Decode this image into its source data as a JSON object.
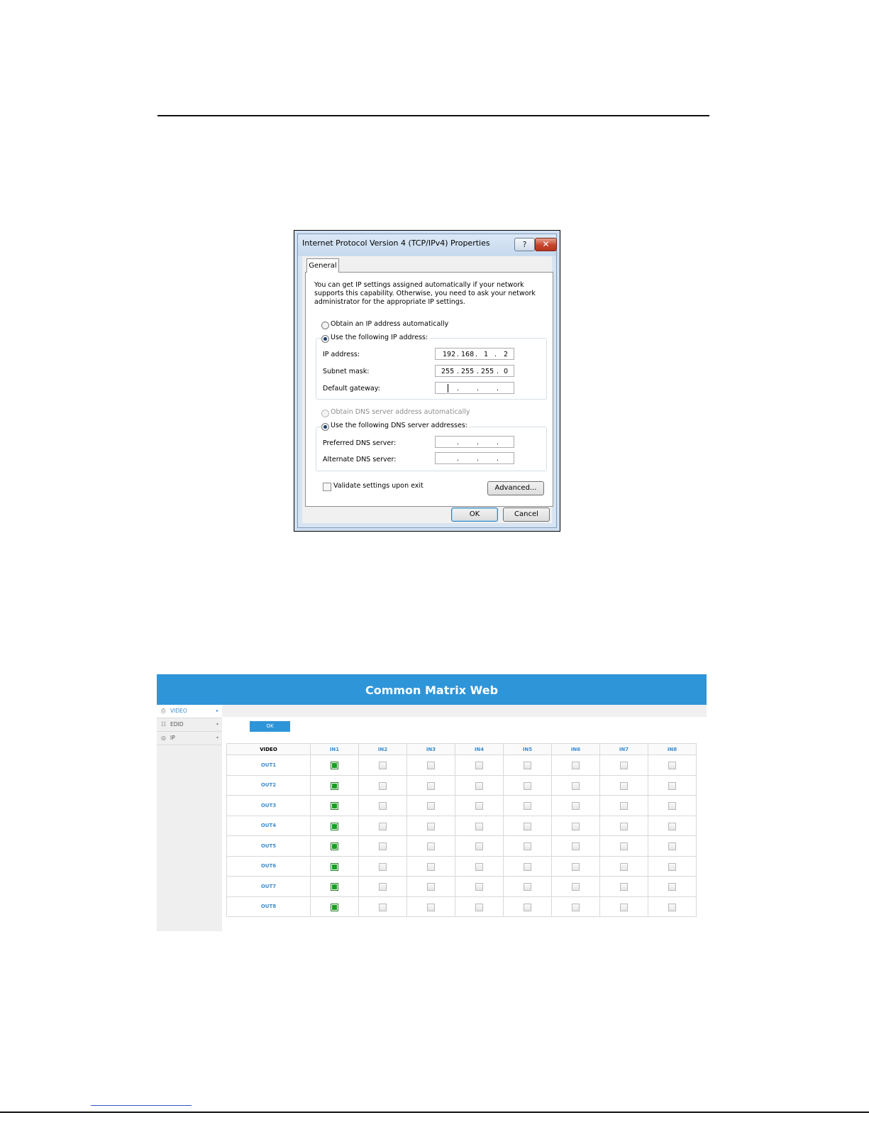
{
  "dialog": {
    "title": "Internet Protocol Version 4 (TCP/IPv4) Properties",
    "help_label": "?",
    "close_label": "✕",
    "tab_label": "General",
    "description": "You can get IP settings assigned automatically if your network supports this capability. Otherwise, you need to ask your network administrator for the appropriate IP settings.",
    "ip_auto_label": "Obtain an IP address automatically",
    "ip_manual_label": "Use the following IP address:",
    "ip_mode": "manual",
    "ip_address_label": "IP address:",
    "ip_address": [
      "192",
      "168",
      "1",
      "2"
    ],
    "subnet_label": "Subnet mask:",
    "subnet": [
      "255",
      "255",
      "255",
      "0"
    ],
    "gateway_label": "Default gateway:",
    "dns_auto_label": "Obtain DNS server address automatically",
    "dns_manual_label": "Use the following DNS server addresses:",
    "dns_mode": "manual",
    "preferred_dns_label": "Preferred DNS server:",
    "alternate_dns_label": "Alternate DNS server:",
    "validate_label": "Validate settings upon exit",
    "validate_checked": false,
    "advanced_label": "Advanced...",
    "ok_label": "OK",
    "cancel_label": "Cancel",
    "dot": "."
  },
  "web": {
    "title": "Common Matrix Web",
    "sidebar": [
      {
        "label": "VIDEO",
        "icon": "video-icon",
        "glyph": "⎙",
        "arrow": "▸",
        "active": true
      },
      {
        "label": "EDID",
        "icon": "edid-icon",
        "glyph": "☷",
        "arrow": "▾",
        "active": false
      },
      {
        "label": "IP",
        "icon": "globe-icon",
        "glyph": "◎",
        "arrow": "▾",
        "active": false
      }
    ],
    "ok_label": "OK",
    "matrix": {
      "corner_label": "VIDEO",
      "inputs": [
        "IN1",
        "IN2",
        "IN3",
        "IN4",
        "IN5",
        "IN6",
        "IN7",
        "IN8"
      ],
      "outputs": [
        "OUT1",
        "OUT2",
        "OUT3",
        "OUT4",
        "OUT5",
        "OUT6",
        "OUT7",
        "OUT8"
      ],
      "routing": [
        1,
        1,
        1,
        1,
        1,
        1,
        1,
        1
      ]
    },
    "colors": {
      "header": "#2e95d9",
      "selected": "#17a01f"
    }
  }
}
